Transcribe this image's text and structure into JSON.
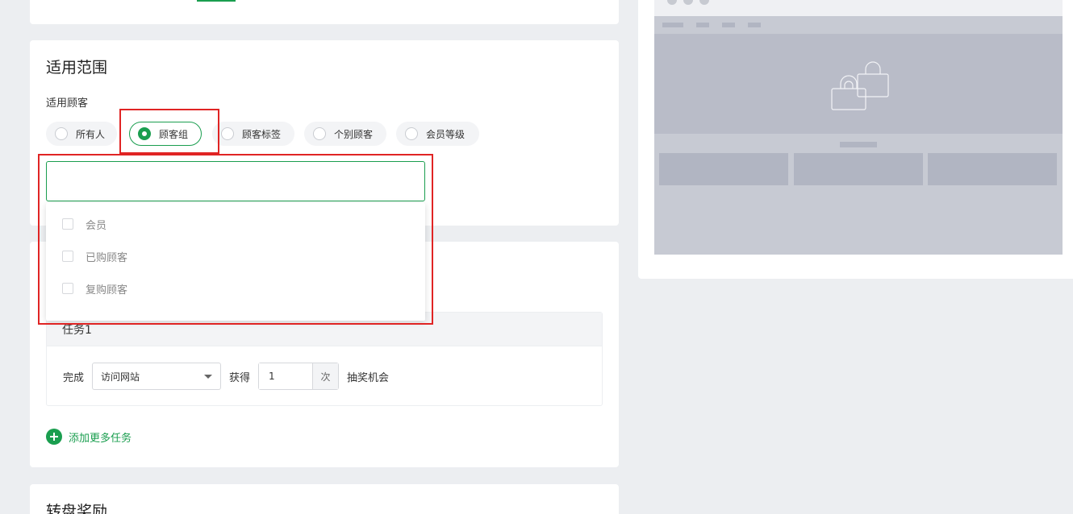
{
  "scope": {
    "title": "适用范围",
    "customer_label": "适用顾客",
    "options": [
      {
        "label": "所有人",
        "selected": false
      },
      {
        "label": "顾客组",
        "selected": true
      },
      {
        "label": "顾客标签",
        "selected": false
      },
      {
        "label": "个别顾客",
        "selected": false
      },
      {
        "label": "会员等级",
        "selected": false
      }
    ],
    "search": {
      "value": "",
      "placeholder": ""
    },
    "groups": [
      "会员",
      "已购顾客",
      "复购顾客"
    ]
  },
  "task": {
    "name": "任务1",
    "complete_label": "完成",
    "action_value": "访问网站",
    "get_label": "获得",
    "count_value": "1",
    "count_unit": "次",
    "reward_label": "抽奖机会",
    "add_more_label": "添加更多任务"
  },
  "wheel": {
    "title": "转盘奖励"
  },
  "colors": {
    "accent": "#1a9e4f",
    "highlight": "#e02424",
    "background": "#eceef1"
  }
}
